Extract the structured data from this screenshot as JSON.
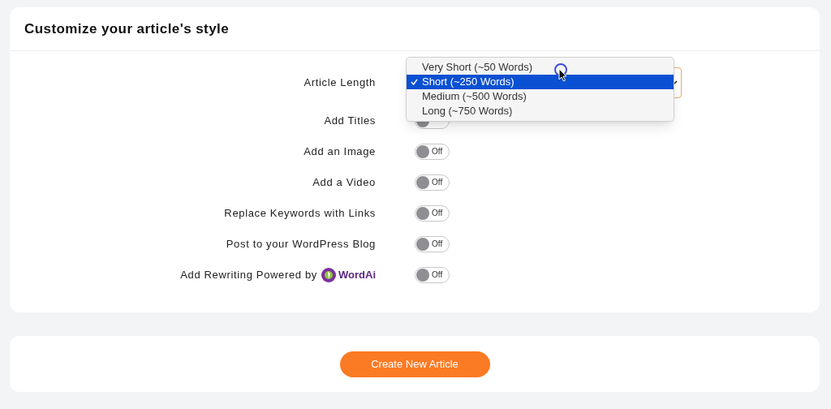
{
  "card_title": "Customize your article's style",
  "settings": [
    {
      "kind": "select",
      "label": "Article Length",
      "menu": [
        {
          "label": "Very Short (~50 Words)",
          "selected": false
        },
        {
          "label": "Short (~250 Words)",
          "selected": true
        },
        {
          "label": "Medium (~500 Words)",
          "selected": false
        },
        {
          "label": "Long (~750 Words)",
          "selected": false
        }
      ]
    },
    {
      "kind": "toggle",
      "label": "Add Titles",
      "on": false
    },
    {
      "kind": "toggle",
      "label": "Add an Image",
      "on": false,
      "state_label": "Off"
    },
    {
      "kind": "toggle",
      "label": "Add a Video",
      "on": false,
      "state_label": "Off"
    },
    {
      "kind": "toggle",
      "label": "Replace Keywords with Links",
      "on": false,
      "state_label": "Off"
    },
    {
      "kind": "toggle",
      "label": "Post to your WordPress Blog",
      "on": false,
      "state_label": "Off"
    },
    {
      "kind": "toggle",
      "label": "Add Rewriting Powered by",
      "logo_text": "WordAi",
      "on": false,
      "state_label": "Off"
    }
  ],
  "create_button": "Create New Article"
}
